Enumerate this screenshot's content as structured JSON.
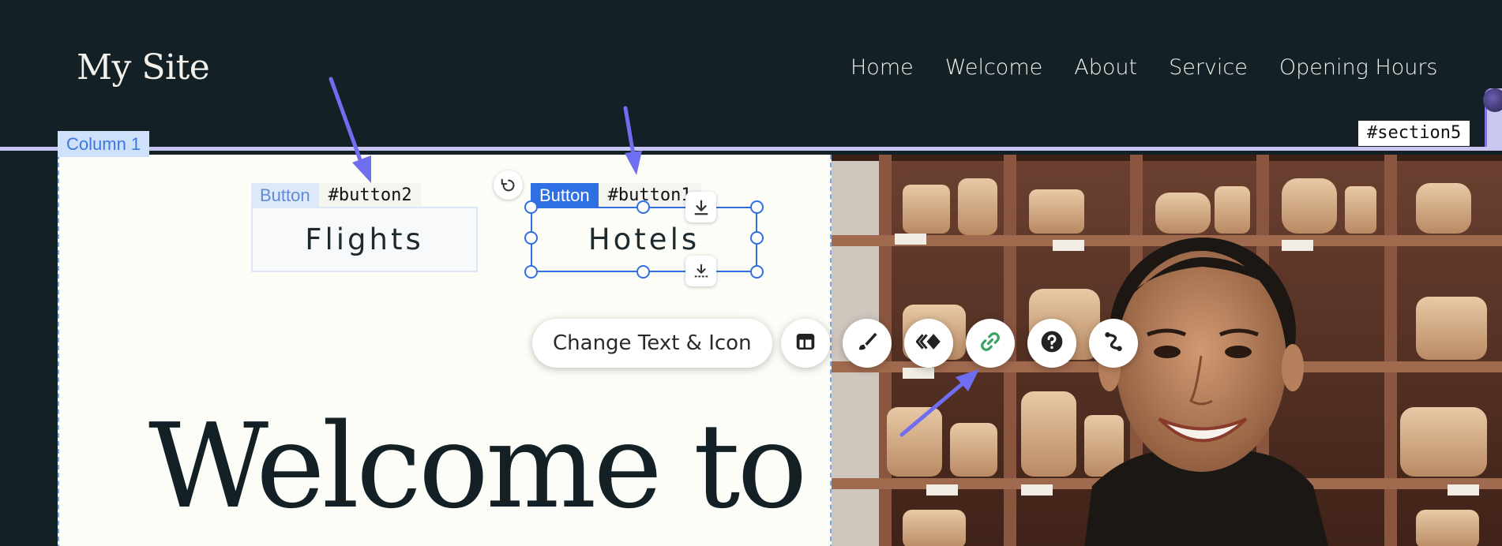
{
  "header": {
    "site_title": "My Site",
    "nav": [
      "Home",
      "Welcome",
      "About",
      "Service",
      "Opening Hours"
    ],
    "section_tag": "#section5"
  },
  "column": {
    "tag": "Column 1"
  },
  "buttons": {
    "flights": {
      "type_tag": "Button",
      "id_tag": "#button2",
      "label": "Flights"
    },
    "hotels": {
      "type_tag": "Button",
      "id_tag": "#button1",
      "label": "Hotels"
    }
  },
  "toolbar": {
    "change_text_label": "Change Text & Icon",
    "tools": [
      "layout-icon",
      "design-brush-icon",
      "animation-icon",
      "link-icon",
      "help-icon",
      "connect-icon"
    ]
  },
  "hero": {
    "heading": "Welcome to"
  },
  "colors": {
    "header_bg": "#132026",
    "selection_blue": "#2f6fe4",
    "annotation_arrow": "#6f6ef0",
    "link_icon_green": "#3aa463"
  }
}
